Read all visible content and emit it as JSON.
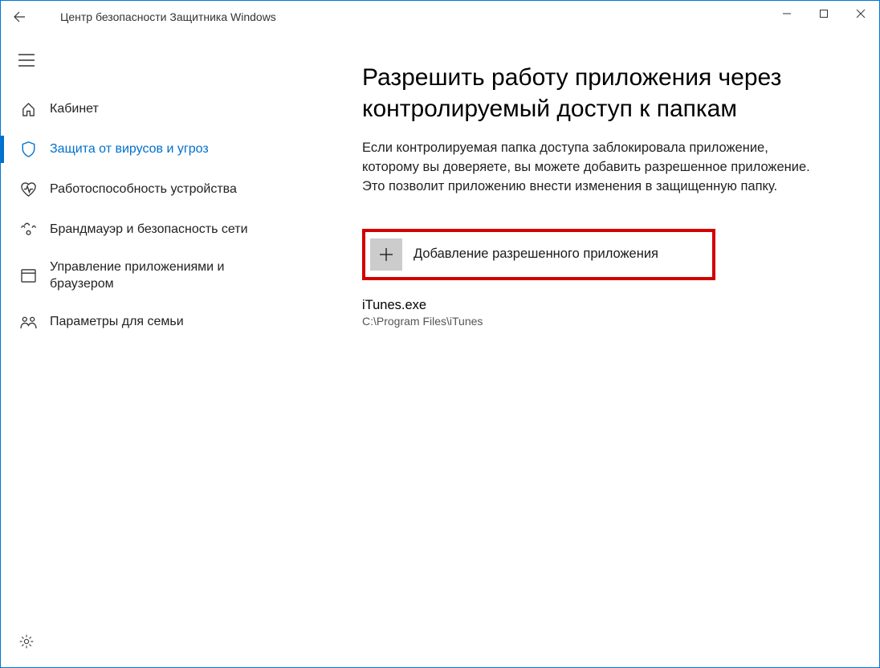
{
  "titlebar": {
    "title": "Центр безопасности Защитника Windows"
  },
  "sidebar": {
    "items": [
      {
        "label": "Кабинет"
      },
      {
        "label": "Защита от вирусов и угроз"
      },
      {
        "label": "Работоспособность устройства"
      },
      {
        "label": "Брандмауэр и безопасность сети"
      },
      {
        "label": "Управление приложениями и браузером"
      },
      {
        "label": "Параметры для семьи"
      }
    ]
  },
  "main": {
    "heading": "Разрешить работу приложения через контролируемый доступ к папкам",
    "description": "Если контролируемая папка доступа заблокировала приложение, которому вы доверяете, вы можете добавить разрешенное приложение. Это позволит приложению внести изменения в защищенную папку.",
    "add_button_label": "Добавление разрешенного приложения",
    "apps": [
      {
        "name": "iTunes.exe",
        "path": "C:\\Program Files\\iTunes"
      }
    ]
  }
}
